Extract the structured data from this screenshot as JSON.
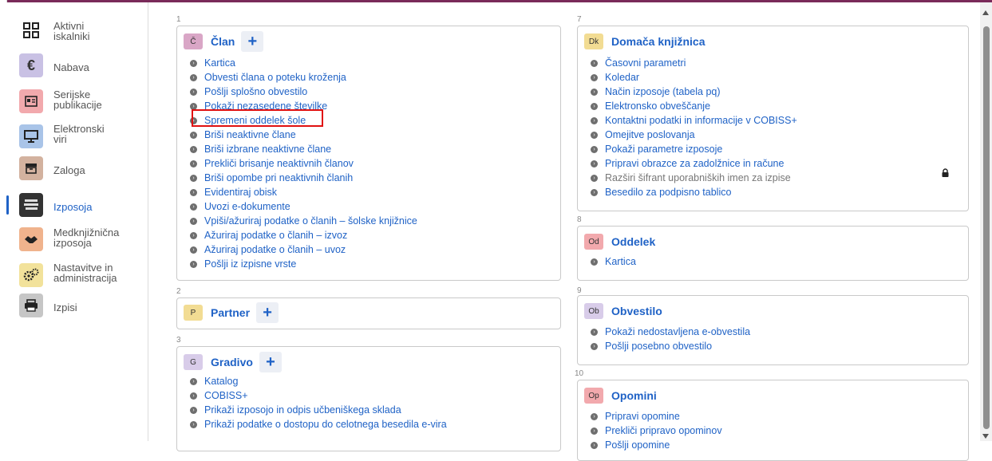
{
  "sidebar": {
    "items": [
      {
        "label": "Aktivni\niskalniki",
        "icon": "grid-icon"
      },
      {
        "label": "Nabava",
        "icon": "euro-icon"
      },
      {
        "label": "Serijske\npublikacije",
        "icon": "newspaper-icon"
      },
      {
        "label": "Elektronski\nviri",
        "icon": "monitor-icon"
      },
      {
        "label": "Zaloga",
        "icon": "archive-icon"
      },
      {
        "label": "Izposoja",
        "icon": "books-icon"
      },
      {
        "label": "Medknjižnična\nizposoja",
        "icon": "handshake-icon"
      },
      {
        "label": "Nastavitve in\nadministracija",
        "icon": "gears-icon"
      },
      {
        "label": "Izpisi",
        "icon": "printer-icon"
      }
    ]
  },
  "sections": {
    "s1": {
      "num": "1",
      "badge": "Č",
      "title": "Član",
      "items": [
        "Kartica",
        "Obvesti člana o poteku kroženja",
        "Pošlji splošno obvestilo",
        "Pokaži nezasedene številke",
        "Spremeni oddelek šole",
        "Briši neaktivne člane",
        "Briši izbrane neaktivne člane",
        "Prekliči brisanje neaktivnih članov",
        "Briši opombe pri neaktivnih članih",
        "Evidentiraj obisk",
        "Uvozi e-dokumente",
        "Vpiši/ažuriraj podatke o članih – šolske knjižnice",
        "Ažuriraj podatke o članih – izvoz",
        "Ažuriraj podatke o članih – uvoz",
        "Pošlji iz izpisne vrste"
      ]
    },
    "s2": {
      "num": "2",
      "badge": "P",
      "title": "Partner"
    },
    "s3": {
      "num": "3",
      "badge": "G",
      "title": "Gradivo",
      "items": [
        "Katalog",
        "COBISS+",
        "Prikaži izposojo in odpis učbeniškega sklada",
        "Prikaži podatke o dostopu do celotnega besedila e-vira"
      ]
    },
    "s7": {
      "num": "7",
      "badge": "Dk",
      "title": "Domača knjižnica",
      "items": [
        "Časovni parametri",
        "Koledar",
        "Način izposoje (tabela pq)",
        "Elektronsko obveščanje",
        "Kontaktni podatki in informacije v COBISS+",
        "Omejitve poslovanja",
        "Pokaži parametre izposoje",
        "Pripravi obrazce za zadolžnice in račune",
        "Razširi šifrant uporabniških imen za izpise",
        "Besedilo za podpisno tablico"
      ]
    },
    "s8": {
      "num": "8",
      "badge": "Od",
      "title": "Oddelek",
      "items": [
        "Kartica"
      ]
    },
    "s9": {
      "num": "9",
      "badge": "Ob",
      "title": "Obvestilo",
      "items": [
        "Pokaži nedostavljena e-obvestila",
        "Pošlji posebno obvestilo"
      ]
    },
    "s10": {
      "num": "10",
      "badge": "Op",
      "title": "Opomini",
      "items": [
        "Pripravi opomine",
        "Prekliči pripravo opominov",
        "Pošlji opomine"
      ]
    }
  },
  "colors": {
    "accent": "#1f62c6",
    "topbar": "#7a2a5a",
    "highlight": "#e01010"
  }
}
